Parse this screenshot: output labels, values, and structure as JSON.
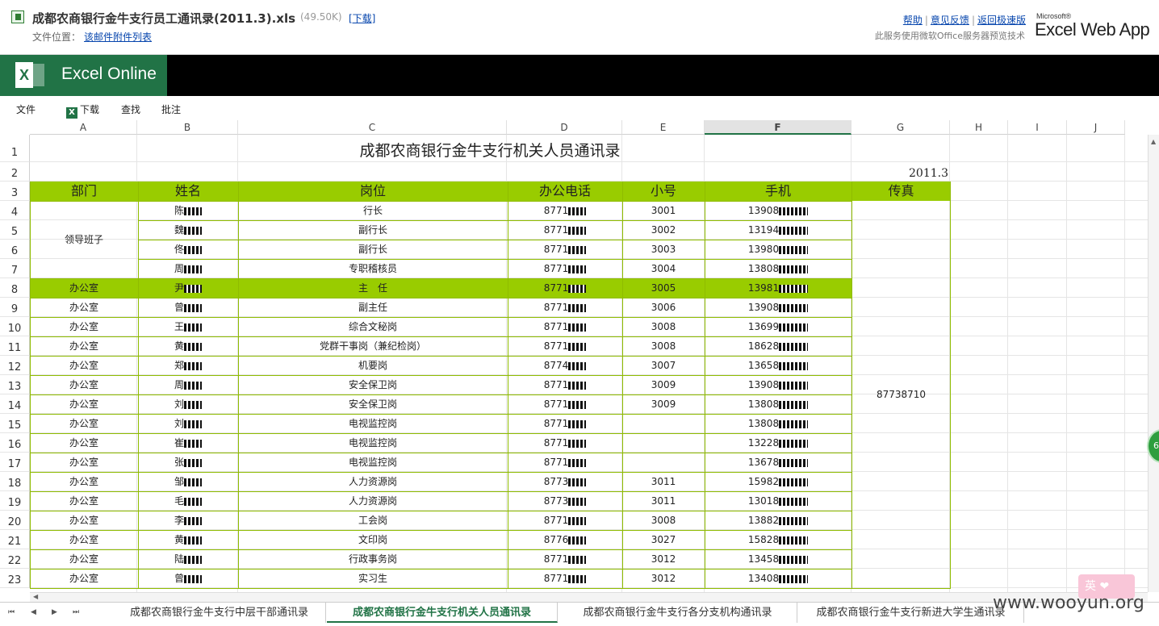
{
  "file": {
    "title": "成都农商银行金牛支行员工通讯录(2011.3).xls",
    "size": "(49.50K)",
    "download": "[下载]",
    "location_label": "文件位置：",
    "location_link": "该邮件附件列表"
  },
  "toplinks": {
    "help": "帮助",
    "feedback": "意见反馈",
    "fast": "返回极速版",
    "note": "此服务使用微软Office服务器预览技术",
    "logo_small": "Microsoft®",
    "logo_main": "Excel Web App"
  },
  "app": {
    "brand": "Excel Online"
  },
  "menu": {
    "file": "文件",
    "download": "下载",
    "find": "查找",
    "comment": "批注"
  },
  "columns": [
    "A",
    "B",
    "C",
    "D",
    "E",
    "F",
    "G",
    "H",
    "I",
    "J"
  ],
  "active_column": "F",
  "rows": [
    "1",
    "2",
    "3",
    "4",
    "5",
    "6",
    "7",
    "8",
    "9",
    "10",
    "11",
    "12",
    "13",
    "14",
    "15",
    "16",
    "17",
    "18",
    "19",
    "20",
    "21",
    "22",
    "23"
  ],
  "sheet": {
    "title": "成都农商银行金牛支行机关人员通讯录",
    "date": "2011.3",
    "headers": [
      "部门",
      "姓名",
      "岗位",
      "办公电话",
      "小号",
      "手机",
      "传真"
    ],
    "leader_dept": "领导班子",
    "fax": "87738710",
    "highlight_color": "#99cc00",
    "data": [
      {
        "dept": "",
        "name": "陈",
        "post": "行长",
        "phone": "8771",
        "ext": "3001",
        "mobile": "13908"
      },
      {
        "dept": "",
        "name": "魏",
        "post": "副行长",
        "phone": "8771",
        "ext": "3002",
        "mobile": "13194"
      },
      {
        "dept": "",
        "name": "佟",
        "post": "副行长",
        "phone": "8771",
        "ext": "3003",
        "mobile": "13980"
      },
      {
        "dept": "",
        "name": "周",
        "post": "专职稽核员",
        "phone": "8771",
        "ext": "3004",
        "mobile": "13808"
      },
      {
        "dept": "办公室",
        "name": "尹",
        "post": "主　任",
        "phone": "8771",
        "ext": "3005",
        "mobile": "13981"
      },
      {
        "dept": "办公室",
        "name": "曾",
        "post": "副主任",
        "phone": "8771",
        "ext": "3006",
        "mobile": "13908"
      },
      {
        "dept": "办公室",
        "name": "王",
        "post": "综合文秘岗",
        "phone": "8771",
        "ext": "3008",
        "mobile": "13699"
      },
      {
        "dept": "办公室",
        "name": "黄",
        "post": "党群干事岗（兼纪检岗）",
        "phone": "8771",
        "ext": "3008",
        "mobile": "18628"
      },
      {
        "dept": "办公室",
        "name": "郑",
        "post": "机要岗",
        "phone": "8774",
        "ext": "3007",
        "mobile": "13658"
      },
      {
        "dept": "办公室",
        "name": "周",
        "post": "安全保卫岗",
        "phone": "8771",
        "ext": "3009",
        "mobile": "13908"
      },
      {
        "dept": "办公室",
        "name": "刘",
        "post": "安全保卫岗",
        "phone": "8771",
        "ext": "3009",
        "mobile": "13808"
      },
      {
        "dept": "办公室",
        "name": "刘",
        "post": "电视监控岗",
        "phone": "8771",
        "ext": "",
        "mobile": "13808"
      },
      {
        "dept": "办公室",
        "name": "崔",
        "post": "电视监控岗",
        "phone": "8771",
        "ext": "",
        "mobile": "13228"
      },
      {
        "dept": "办公室",
        "name": "张",
        "post": "电视监控岗",
        "phone": "8771",
        "ext": "",
        "mobile": "13678"
      },
      {
        "dept": "办公室",
        "name": "邹",
        "post": "人力资源岗",
        "phone": "8773",
        "ext": "3011",
        "mobile": "15982"
      },
      {
        "dept": "办公室",
        "name": "毛",
        "post": "人力资源岗",
        "phone": "8773",
        "ext": "3011",
        "mobile": "13018"
      },
      {
        "dept": "办公室",
        "name": "李",
        "post": "工会岗",
        "phone": "8771",
        "ext": "3008",
        "mobile": "13882"
      },
      {
        "dept": "办公室",
        "name": "黄",
        "post": "文印岗",
        "phone": "8776",
        "ext": "3027",
        "mobile": "15828"
      },
      {
        "dept": "办公室",
        "name": "陆",
        "post": "行政事务岗",
        "phone": "8771",
        "ext": "3012",
        "mobile": "13458"
      },
      {
        "dept": "办公室",
        "name": "曾",
        "post": "实习生",
        "phone": "8771",
        "ext": "3012",
        "mobile": "13408"
      }
    ]
  },
  "tabs": [
    "成都农商银行金牛支行中层干部通讯录",
    "成都农商银行金牛支行机关人员通讯录",
    "成都农商银行金牛支行各分支机构通讯录",
    "成都农商银行金牛支行新进大学生通讯录"
  ],
  "active_tab": 1,
  "overlay": {
    "circle": "6",
    "ime": "英",
    "watermark": "www.wooyun.org"
  }
}
